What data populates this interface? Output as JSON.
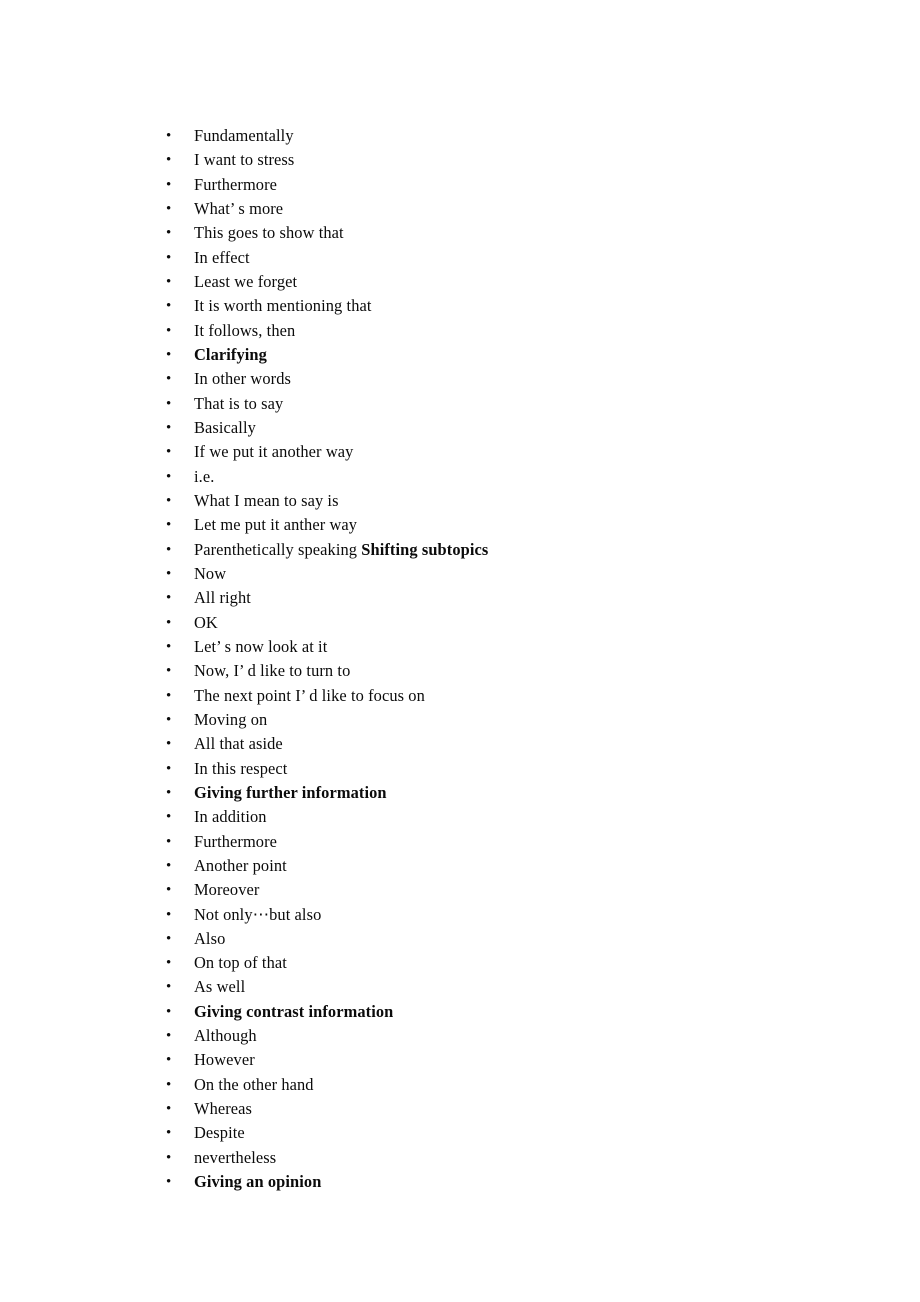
{
  "document": {
    "background_color": "#ffffff",
    "text_color": "#0b0b0b",
    "bullet_glyph": "•"
  },
  "list": {
    "items": [
      {
        "text": "Fundamentally",
        "bold": false
      },
      {
        "text": "I want to stress",
        "bold": false
      },
      {
        "text": "Furthermore",
        "bold": false
      },
      {
        "text": "What’ s more",
        "bold": false
      },
      {
        "text": "This goes to show that",
        "bold": false
      },
      {
        "text": "In effect",
        "bold": false
      },
      {
        "text": "Least we forget",
        "bold": false
      },
      {
        "text": "It is worth mentioning that",
        "bold": false
      },
      {
        "text": "It follows, then",
        "bold": false
      },
      {
        "text": "Clarifying",
        "bold": true
      },
      {
        "text": "In other words",
        "bold": false
      },
      {
        "text": "That is to say",
        "bold": false
      },
      {
        "text": "Basically",
        "bold": false
      },
      {
        "text": "If we put it another way",
        "bold": false
      },
      {
        "text": "i.e.",
        "bold": false
      },
      {
        "text": "What I mean to say is",
        "bold": false
      },
      {
        "text": "Let me put it anther way",
        "bold": false
      },
      {
        "text": "Parenthetically speaking",
        "bold": false,
        "trailing_bold": "Shifting subtopics"
      },
      {
        "text": "Now",
        "bold": false
      },
      {
        "text": "All right",
        "bold": false
      },
      {
        "text": "OK",
        "bold": false
      },
      {
        "text": "Let’ s now look at it",
        "bold": false
      },
      {
        "text": "Now, I’ d like to turn to",
        "bold": false
      },
      {
        "text": "The next point I’ d like to focus on",
        "bold": false
      },
      {
        "text": "Moving on",
        "bold": false
      },
      {
        "text": "All that aside",
        "bold": false
      },
      {
        "text": "In this respect",
        "bold": false
      },
      {
        "text": "Giving further information",
        "bold": true
      },
      {
        "text": "In addition",
        "bold": false
      },
      {
        "text": "Furthermore",
        "bold": false
      },
      {
        "text": "Another point",
        "bold": false
      },
      {
        "text": "Moreover",
        "bold": false
      },
      {
        "text": "Not only⋯but also",
        "bold": false
      },
      {
        "text": "Also",
        "bold": false
      },
      {
        "text": "On top of that",
        "bold": false
      },
      {
        "text": "As well",
        "bold": false
      },
      {
        "text": "Giving contrast information",
        "bold": true
      },
      {
        "text": "Although",
        "bold": false
      },
      {
        "text": "However",
        "bold": false
      },
      {
        "text": "On the other hand",
        "bold": false
      },
      {
        "text": "Whereas",
        "bold": false
      },
      {
        "text": "Despite",
        "bold": false
      },
      {
        "text": "nevertheless",
        "bold": false
      },
      {
        "text": "Giving an opinion",
        "bold": true
      }
    ]
  }
}
